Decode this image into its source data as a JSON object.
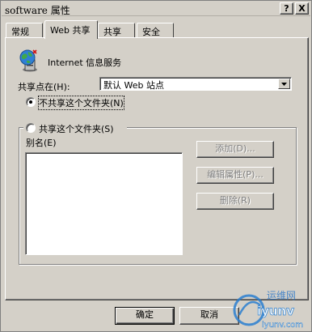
{
  "window": {
    "title": "software 属性",
    "help_glyph": "?",
    "close_glyph": "X"
  },
  "tabs": [
    {
      "label": "常规"
    },
    {
      "label": "Web 共享",
      "active": true
    },
    {
      "label": "共享"
    },
    {
      "label": "安全"
    }
  ],
  "service": {
    "icon": "globe-server-icon",
    "label": "Internet 信息服务"
  },
  "share_on": {
    "label": "共享点在(H):",
    "value": "默认 Web 站点"
  },
  "options": {
    "no_share_label": "不共享这个文件夹(N)",
    "share_label": "共享这个文件夹(S)",
    "selected": "no_share"
  },
  "alias": {
    "label": "别名(E)",
    "items": []
  },
  "buttons": {
    "add": "添加(D)...",
    "edit": "编辑属性(P)...",
    "remove": "删除(R)",
    "ok": "确定",
    "cancel": "取消"
  },
  "watermark": {
    "text_top": "运维网",
    "text_mid": "iyunv",
    "text_bottom": "iyunv.com"
  },
  "colors": {
    "face": "#d4d0c8",
    "shadow": "#808080",
    "dark": "#404040",
    "highlight": "#ffffff",
    "watermark_blue": "#2a7fd0"
  }
}
